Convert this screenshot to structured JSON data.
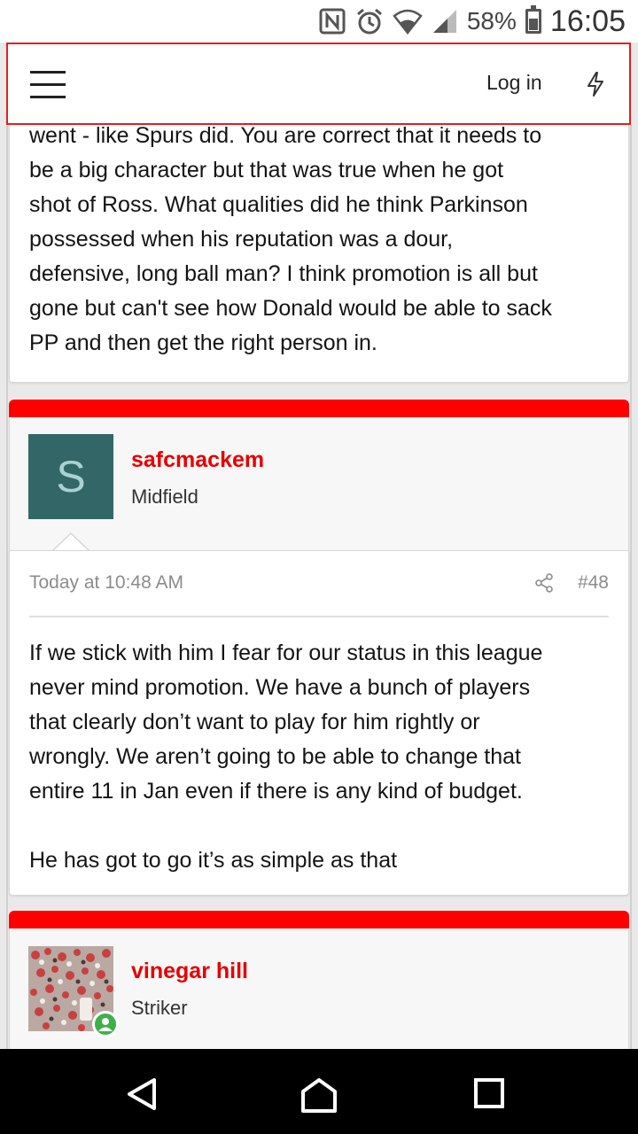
{
  "status_bar": {
    "battery": "58%",
    "time": "16:05",
    "icons": [
      "nfc-icon",
      "alarm-icon",
      "wifi-icon",
      "signal-icon",
      "battery-icon"
    ]
  },
  "header": {
    "login_label": "Log in",
    "menu_icon": "hamburger-icon",
    "whats_new_icon": "bolt-icon",
    "accent_color": "#e02020"
  },
  "posts": [
    {
      "body": "went - like Spurs did. You are correct that it needs to\nbe a big character but that was true when he got\nshot of Ross. What qualities did he think Parkinson\npossessed when his reputation was a dour,\ndefensive, long ball man? I think promotion is all but\ngone but can't see how Donald would be able to sack\nPP and then get the right person in."
    },
    {
      "username": "safcmackem",
      "user_title": "Midfield",
      "avatar_letter": "S",
      "avatar_color": "#336666",
      "date": "Today at 10:48 AM",
      "post_number": "#48",
      "body": "If we stick with him I fear for our status in this league\nnever mind promotion. We have a bunch of players\nthat clearly don’t want to play for him rightly or\nwrongly. We aren’t going to be able to change that\nentire 11 in Jan even if there is any kind of budget.\n\nHe has got to go it’s as simple as that"
    },
    {
      "username": "vinegar hill",
      "user_title": "Striker",
      "avatar_icon": "crowd-photo",
      "online_icon": "online-user-icon"
    }
  ],
  "colors": {
    "post_accent": "#ff0000",
    "username": "#e60000",
    "online": "#3fb049"
  },
  "nav_bar": {
    "icons": [
      "back-icon",
      "home-icon",
      "recents-icon"
    ]
  }
}
